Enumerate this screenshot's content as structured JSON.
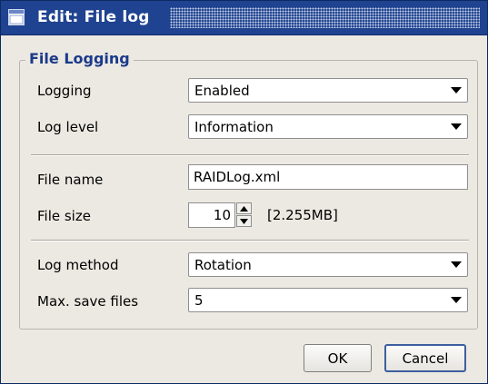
{
  "window": {
    "title": "Edit: File log"
  },
  "group": {
    "title": "File Logging"
  },
  "logging": {
    "label": "Logging",
    "value": "Enabled"
  },
  "log_level": {
    "label": "Log level",
    "value": "Information"
  },
  "file_name": {
    "label": "File name",
    "value": "RAIDLog.xml"
  },
  "file_size": {
    "label": "File size",
    "value": "10",
    "hint": "[2.255MB]"
  },
  "log_method": {
    "label": "Log method",
    "value": "Rotation"
  },
  "max_save_files": {
    "label": "Max. save files",
    "value": "5"
  },
  "buttons": {
    "ok": "OK",
    "cancel": "Cancel"
  },
  "icons": {
    "window": "window-icon",
    "dropdown": "chevron-down-icon",
    "spin_up": "triangle-up-icon",
    "spin_down": "triangle-down-icon"
  },
  "colors": {
    "titlebar": "#1f4390",
    "group_title": "#1a3a8a",
    "default_button_border": "#3d5f9e"
  }
}
